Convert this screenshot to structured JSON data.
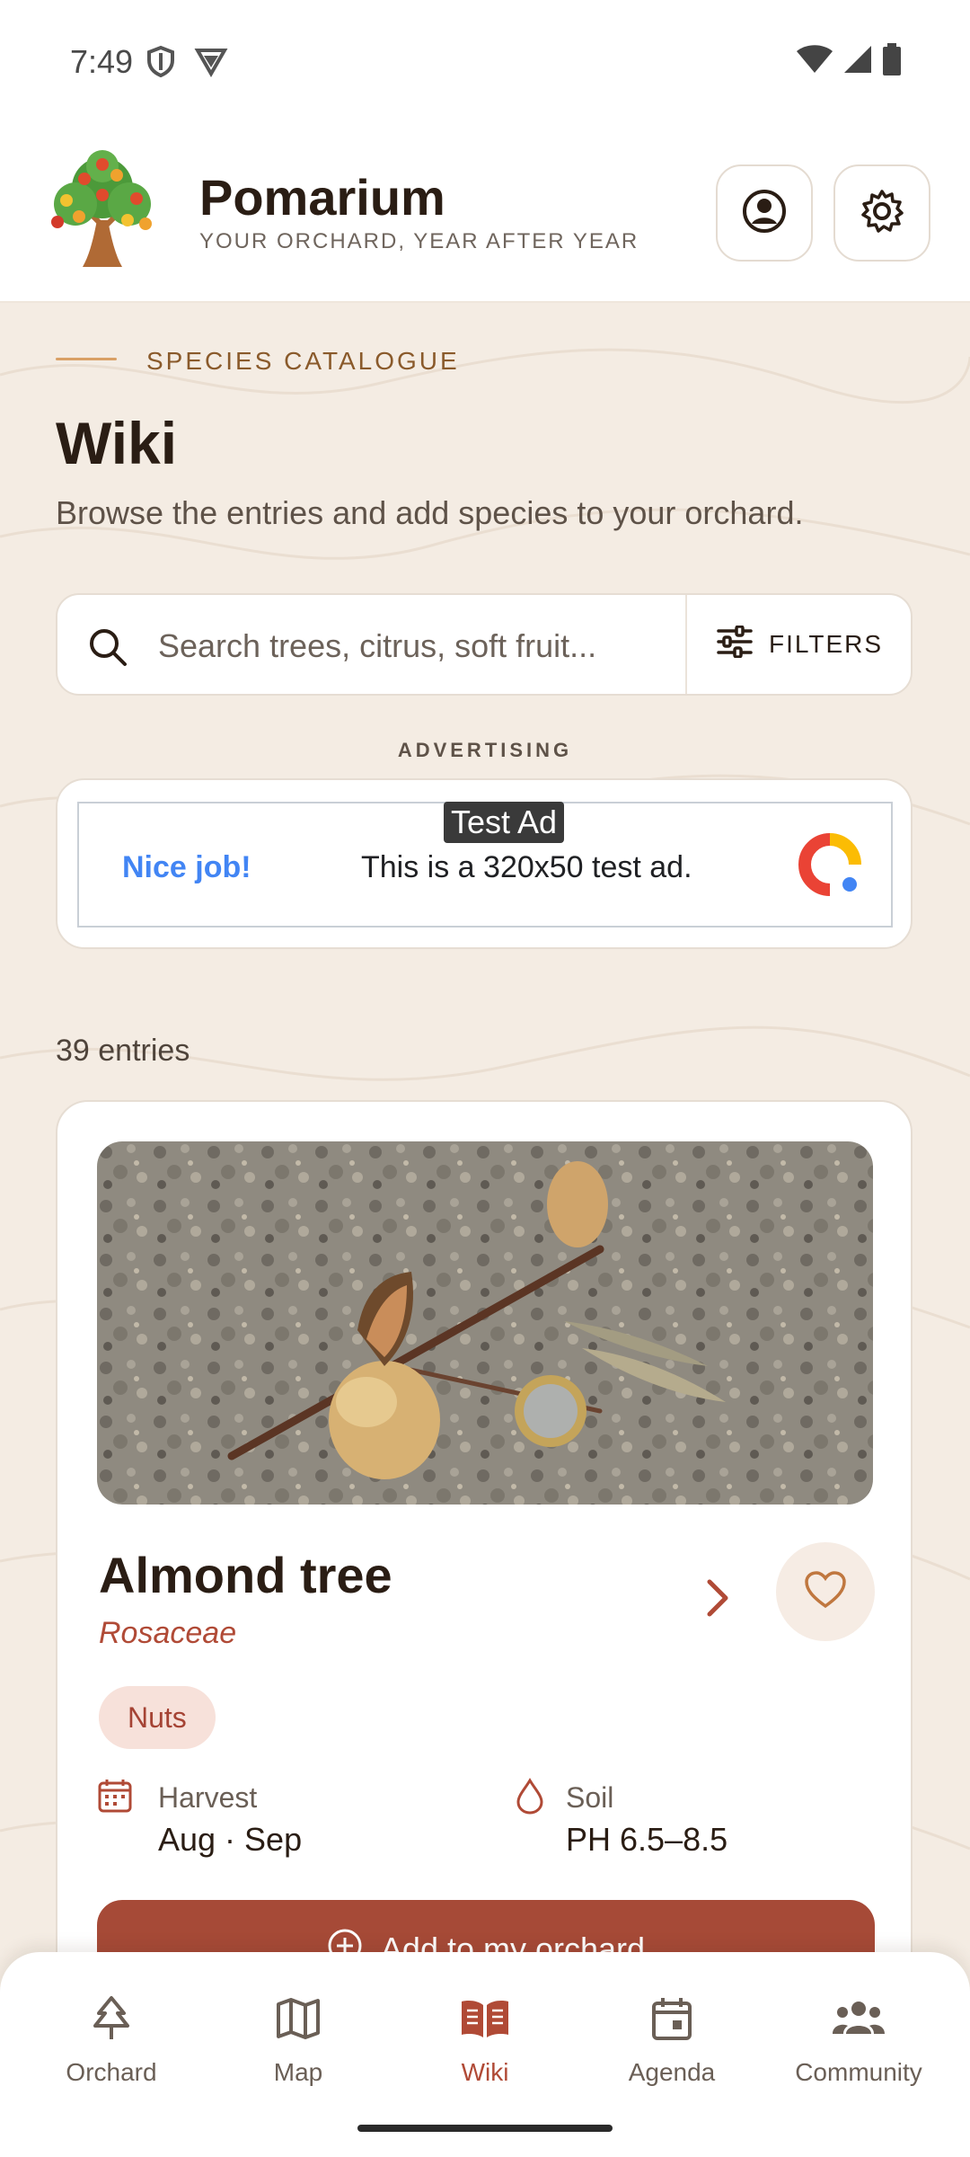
{
  "status_bar": {
    "time": "7:49"
  },
  "header": {
    "app_name": "Pomarium",
    "tagline": "YOUR ORCHARD, YEAR AFTER YEAR"
  },
  "page": {
    "kicker": "SPECIES CATALOGUE",
    "title": "Wiki",
    "subtitle": "Browse the entries and add species to your orchard."
  },
  "search": {
    "placeholder": "Search trees, citrus, soft fruit...",
    "value": "",
    "filters_label": "FILTERS"
  },
  "ad": {
    "section_label": "ADVERTISING",
    "badge": "Test Ad",
    "headline": "Nice job!",
    "text": "This is a 320x50 test ad."
  },
  "results": {
    "count_text": "39 entries"
  },
  "entries": [
    {
      "name": "Almond tree",
      "family": "Rosaceae",
      "tag": "Nuts",
      "harvest_label": "Harvest",
      "harvest_value": "Aug · Sep",
      "soil_label": "Soil",
      "soil_value": "PH 6.5–8.5",
      "add_label": "Add to my orchard"
    }
  ],
  "bottom_nav": [
    {
      "label": "Orchard",
      "icon": "tree-icon",
      "active": false
    },
    {
      "label": "Map",
      "icon": "map-icon",
      "active": false
    },
    {
      "label": "Wiki",
      "icon": "book-icon",
      "active": true
    },
    {
      "label": "Agenda",
      "icon": "calendar-icon",
      "active": false
    },
    {
      "label": "Community",
      "icon": "people-icon",
      "active": false
    }
  ],
  "colors": {
    "accent": "#a64a37",
    "accent_text": "#b04a36",
    "kicker": "#8a5a2b",
    "background": "#f4ece3"
  }
}
